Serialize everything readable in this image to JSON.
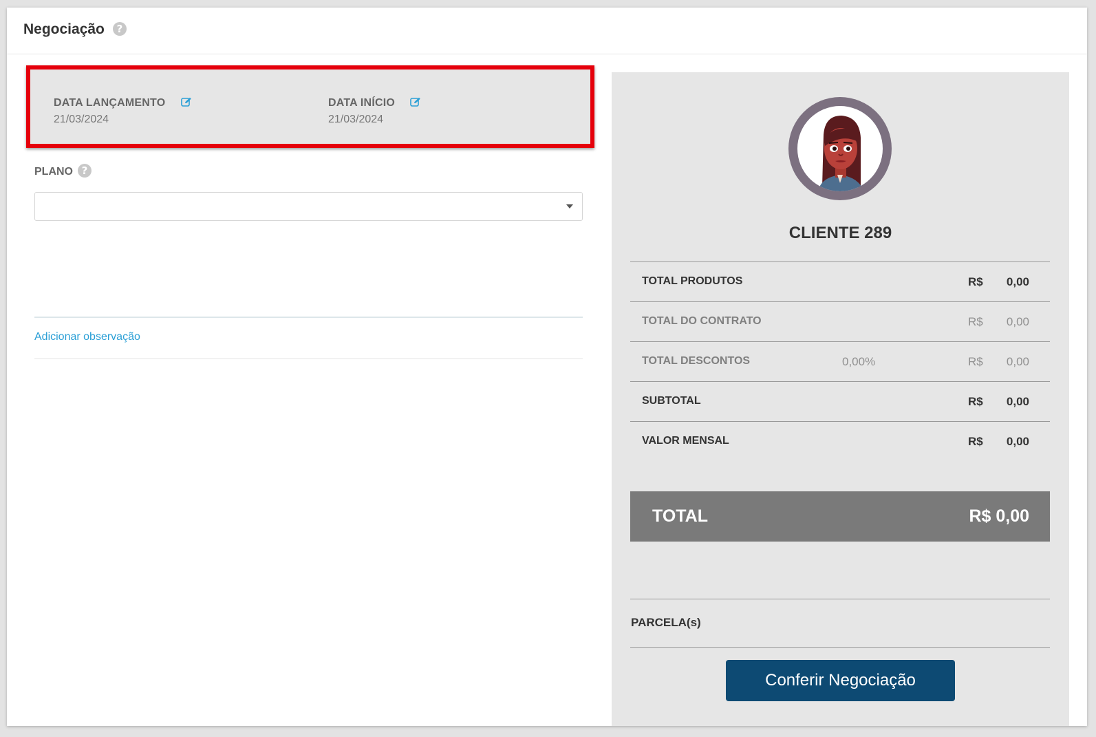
{
  "header": {
    "title": "Negociação",
    "help_icon": "question-circle-icon"
  },
  "dates": {
    "launch_label": "DATA LANÇAMENTO",
    "launch_value": "21/03/2024",
    "start_label": "DATA INÍCIO",
    "start_value": "21/03/2024",
    "edit_icon": "edit-icon",
    "highlight_color": "#e5000b"
  },
  "plano": {
    "label": "PLANO",
    "selected": ""
  },
  "observation_link": "Adicionar observação",
  "summary": {
    "client_name": "CLIENTE 289",
    "rows": [
      {
        "label": "TOTAL PRODUTOS",
        "percent": "",
        "currency": "R$",
        "value": "0,00"
      },
      {
        "label": "TOTAL DO CONTRATO",
        "percent": "",
        "currency": "R$",
        "value": "0,00"
      },
      {
        "label": "TOTAL DESCONTOS",
        "percent": "0,00%",
        "currency": "R$",
        "value": "0,00"
      },
      {
        "label": "SUBTOTAL",
        "percent": "",
        "currency": "R$",
        "value": "0,00"
      },
      {
        "label": "VALOR MENSAL",
        "percent": "",
        "currency": "R$",
        "value": "0,00"
      }
    ],
    "total_label": "TOTAL",
    "total_value": "R$ 0,00",
    "parcelas_label": "PARCELA(s)",
    "confirm_button": "Conferir Negociação"
  },
  "colors": {
    "primary_button": "#0d4a73",
    "link": "#2a9fd6",
    "total_bar": "#7a7a7a"
  }
}
